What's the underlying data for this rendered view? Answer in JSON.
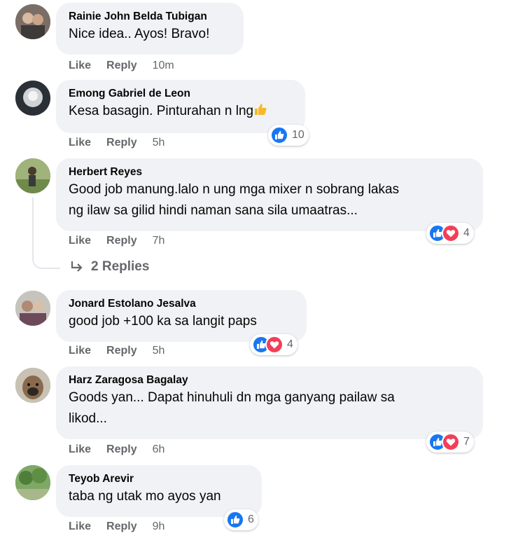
{
  "comments": [
    {
      "name": "Rainie John Belda Tubigan",
      "text": "Nice idea.. Ayos! Bravo!",
      "like": "Like",
      "reply": "Reply",
      "time": "10m"
    },
    {
      "name": "Emong Gabriel de Leon",
      "text": "Kesa basagin. Pinturahan n lng",
      "emoji": "thumbs-up-emoji",
      "like": "Like",
      "reply": "Reply",
      "time": "5h",
      "reactions": {
        "types": [
          "like"
        ],
        "count": "10"
      }
    },
    {
      "name": "Herbert Reyes",
      "text_line1": "Good job manung.lalo n ung mga mixer n sobrang lakas",
      "text_line2": "ng ilaw sa gilid hindi naman sana sila umaatras...",
      "like": "Like",
      "reply": "Reply",
      "time": "7h",
      "reactions": {
        "types": [
          "like",
          "love"
        ],
        "count": "4"
      },
      "replies_label": "2 Replies"
    },
    {
      "name": "Jonard Estolano Jesalva",
      "text": "good job +100 ka sa langit paps",
      "like": "Like",
      "reply": "Reply",
      "time": "5h",
      "reactions": {
        "types": [
          "like",
          "love"
        ],
        "count": "4"
      }
    },
    {
      "name": "Harz Zaragosa Bagalay",
      "text_line1": "Goods yan... Dapat hinuhuli dn mga ganyang pailaw sa",
      "text_line2": "likod...",
      "like": "Like",
      "reply": "Reply",
      "time": "6h",
      "reactions": {
        "types": [
          "like",
          "love"
        ],
        "count": "7"
      }
    },
    {
      "name": "Teyob Arevir",
      "text": "taba ng utak mo ayos yan",
      "like": "Like",
      "reply": "Reply",
      "time": "9h",
      "reactions": {
        "types": [
          "like"
        ],
        "count": "6"
      }
    }
  ],
  "colors": {
    "like": "#1877f2",
    "love": "#f33e58",
    "bubble": "#f0f2f5",
    "meta": "#65676b"
  }
}
